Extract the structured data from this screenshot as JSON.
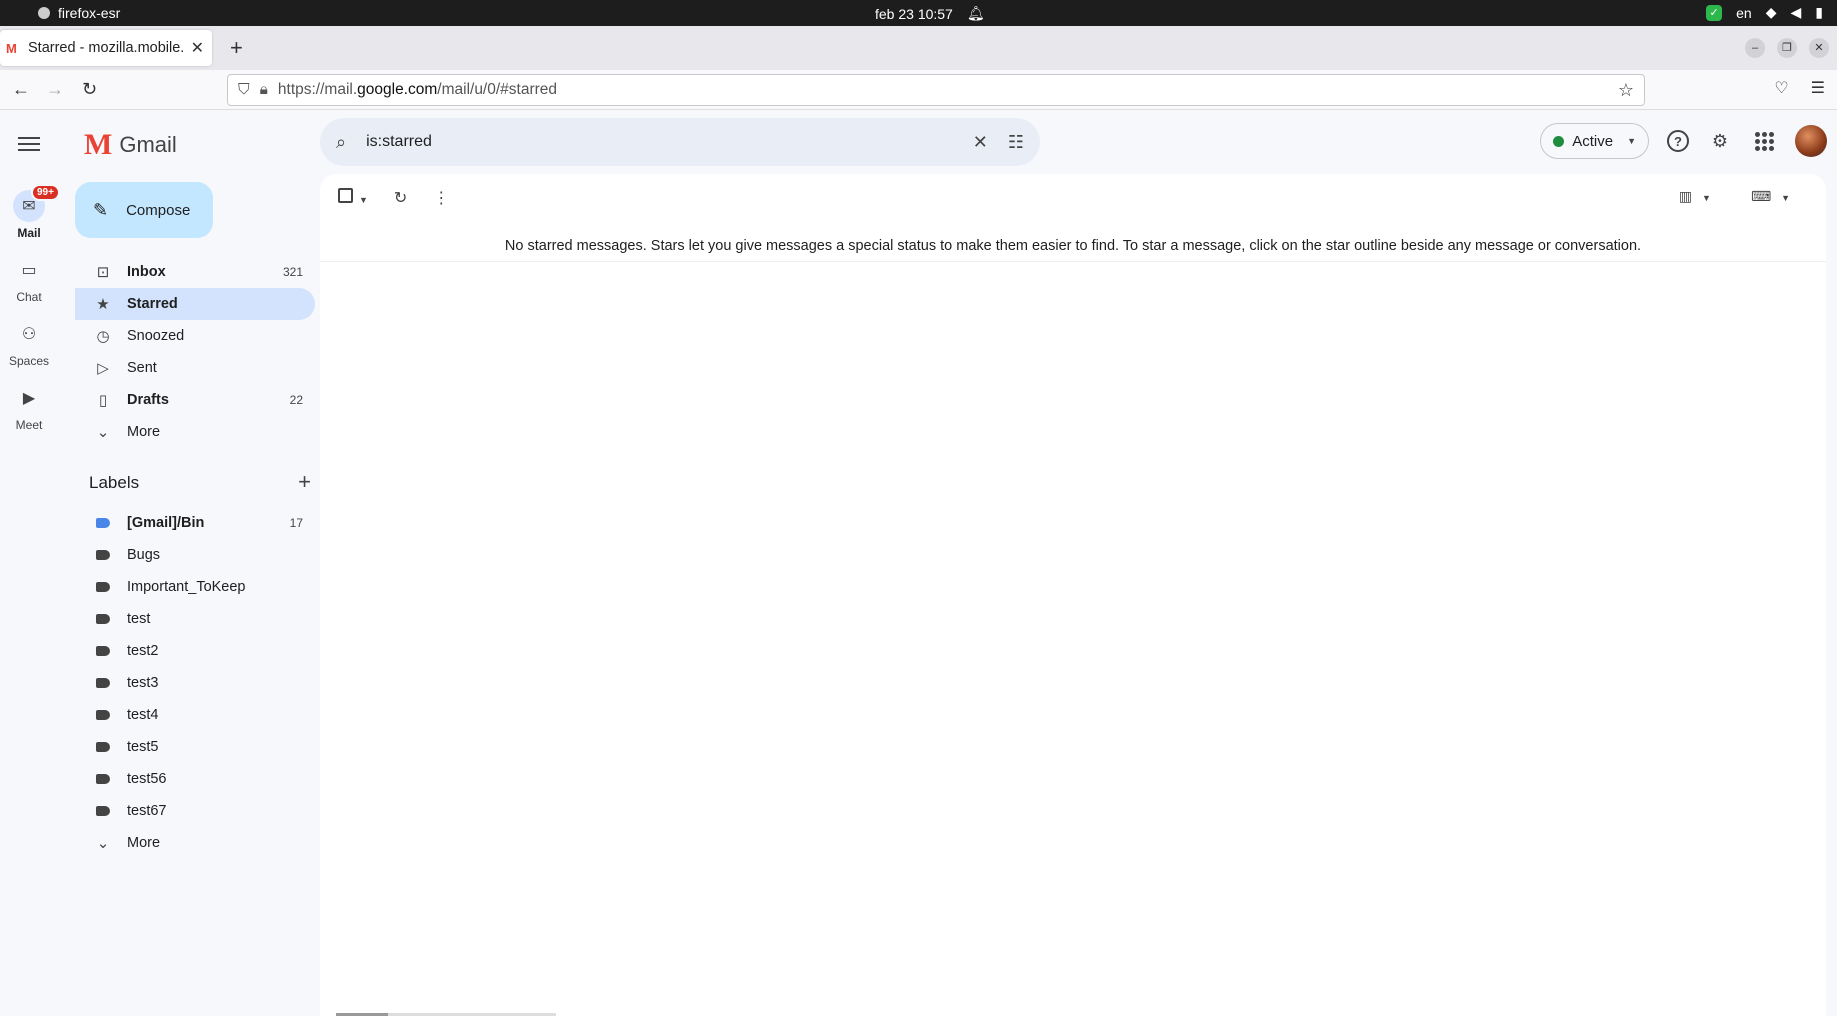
{
  "os": {
    "app_name": "firefox-esr",
    "datetime": "feb 23  10:57",
    "lang": "en"
  },
  "browser": {
    "tab_title": "Starred - mozilla.mobile.b",
    "url_prefix": "https://mail.",
    "url_host": "google.com",
    "url_path": "/mail/u/0/#starred"
  },
  "rail": {
    "mail_badge": "99+",
    "items": [
      {
        "label": "Mail",
        "icon": "mail-icon"
      },
      {
        "label": "Chat",
        "icon": "chat-icon"
      },
      {
        "label": "Spaces",
        "icon": "spaces-icon"
      },
      {
        "label": "Meet",
        "icon": "meet-icon"
      }
    ]
  },
  "gmail": {
    "app_name": "Gmail",
    "compose_label": "Compose",
    "nav": [
      {
        "label": "Inbox",
        "count": "321"
      },
      {
        "label": "Starred",
        "count": ""
      },
      {
        "label": "Snoozed",
        "count": ""
      },
      {
        "label": "Sent",
        "count": ""
      },
      {
        "label": "Drafts",
        "count": "22"
      },
      {
        "label": "More",
        "count": ""
      }
    ],
    "labels_title": "Labels",
    "labels": [
      {
        "label": "[Gmail]/Bin",
        "count": "17"
      },
      {
        "label": "Bugs"
      },
      {
        "label": "Important_ToKeep"
      },
      {
        "label": "test"
      },
      {
        "label": "test2"
      },
      {
        "label": "test3"
      },
      {
        "label": "test4"
      },
      {
        "label": "test5"
      },
      {
        "label": "test56"
      },
      {
        "label": "test67"
      },
      {
        "label": "More"
      }
    ]
  },
  "search": {
    "query": "is:starred"
  },
  "status": {
    "label": "Active",
    "color": "#1e8e3e"
  },
  "main": {
    "empty_message": "No starred messages. Stars let you give messages a special status to make them easier to find. To star a message, click on the star outline beside any message or conversation."
  },
  "colors": {
    "accent": "#c2e7ff",
    "selected": "#d3e3fd",
    "badge": "#d93025"
  }
}
